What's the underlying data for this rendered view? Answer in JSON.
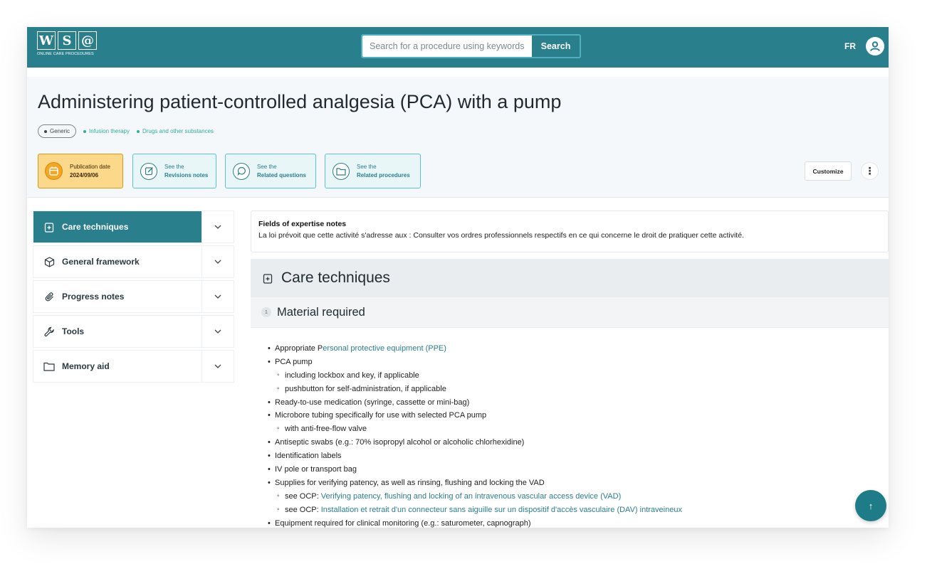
{
  "header": {
    "logo_letters": [
      "W",
      "S",
      "@"
    ],
    "logo_subtitle": "ONLINE CARE PROCEDURES",
    "search_placeholder": "Search for a procedure using keywords",
    "search_button": "Search",
    "language": "FR"
  },
  "page": {
    "title": "Administering patient-controlled analgesia (PCA) with a pump",
    "tags": {
      "generic": "Generic",
      "categories": [
        "Infusion therapy",
        "Drugs and other substances"
      ]
    },
    "publication": {
      "label": "Publication date",
      "value": "2024/09/06"
    },
    "cards": [
      {
        "line1": "See the",
        "line2": "Revisions notes"
      },
      {
        "line1": "See the",
        "line2": "Related questions"
      },
      {
        "line1": "See the",
        "line2": "Related procedures"
      }
    ],
    "customize": "Customize",
    "more": "⋮"
  },
  "sidebar": {
    "items": [
      {
        "label": "Care techniques",
        "icon": "clipboard-plus-icon",
        "active": true
      },
      {
        "label": "General framework",
        "icon": "cube-icon",
        "active": false
      },
      {
        "label": "Progress notes",
        "icon": "paperclip-icon",
        "active": false
      },
      {
        "label": "Tools",
        "icon": "wrench-icon",
        "active": false
      },
      {
        "label": "Memory aid",
        "icon": "folder-icon",
        "active": false
      }
    ]
  },
  "content": {
    "notes_title": "Fields of expertise notes",
    "notes_text": "La loi prévoit que cette activité s'adresse aux : Consulter vos ordres professionnels respectifs en ce qui concerne le droit de pratiquer cette activité.",
    "section_title": "Care techniques",
    "subsection_number": "1",
    "subsection_title": "Material required",
    "list": [
      {
        "level": 1,
        "text": "Appropriate P",
        "link": "ersonal protective equipment (PPE)"
      },
      {
        "level": 1,
        "text": "PCA pump"
      },
      {
        "level": 2,
        "text": "including lockbox and key, if applicable"
      },
      {
        "level": 2,
        "text": "pushbutton for self-administration, if applicable"
      },
      {
        "level": 1,
        "text": "Ready-to-use medication (syringe, cassette or mini-bag)"
      },
      {
        "level": 1,
        "text": "Microbore tubing specifically for use with selected PCA pump"
      },
      {
        "level": 2,
        "text": "with anti-free-flow valve"
      },
      {
        "level": 1,
        "text": "Antiseptic swabs (e.g.: 70% isopropyl alcohol or alcoholic chlorhexidine)"
      },
      {
        "level": 1,
        "text": "Identification labels"
      },
      {
        "level": 1,
        "text": "IV pole or transport bag"
      },
      {
        "level": 1,
        "text": "Supplies for verifying patency, as well as rinsing, flushing and locking the VAD"
      },
      {
        "level": 2,
        "text": "see OCP: ",
        "link": "Verifying patency, flushing and locking of an intravenous vascular access device (VAD)"
      },
      {
        "level": 2,
        "text": "see OCP: ",
        "link": "Installation et retrait d'un connecteur sans aiguille sur un dispositif d'accès vasculaire (DAV) intraveineux"
      },
      {
        "level": 1,
        "text": "Equipment required for clinical monitoring (e.g.: saturometer, capnograph)"
      }
    ]
  },
  "fab": "↑",
  "colors": {
    "primary": "#2a7f8d",
    "accent_teal": "#2fae9c",
    "publication_bg": "#fbd88a"
  }
}
